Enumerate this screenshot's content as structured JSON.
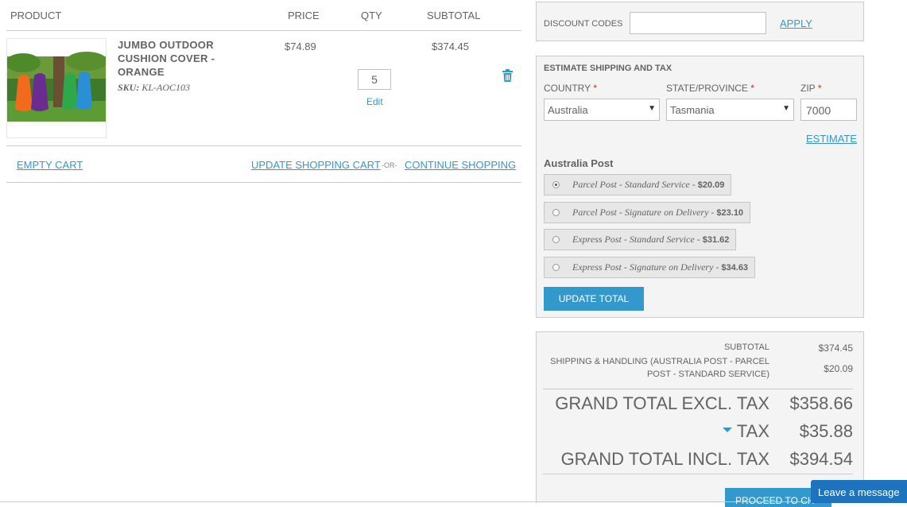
{
  "cart": {
    "headers": {
      "product": "PRODUCT",
      "price": "PRICE",
      "qty": "QTY",
      "subtotal": "SUBTOTAL"
    },
    "item": {
      "name": "JUMBO OUTDOOR CUSHION COVER - ORANGE",
      "sku_label": "SKU:",
      "sku_value": "KL-AOC103",
      "price": "$74.89",
      "qty": "5",
      "edit_label": "Edit",
      "subtotal": "$374.45",
      "remove_icon": "trash-icon"
    },
    "actions": {
      "empty_cart": "EMPTY CART",
      "update_cart": "UPDATE SHOPPING CART",
      "or": "-OR-",
      "continue": "CONTINUE SHOPPING"
    }
  },
  "discount": {
    "label": "DISCOUNT CODES",
    "value": "",
    "apply": "APPLY"
  },
  "shipping": {
    "title": "ESTIMATE SHIPPING AND TAX",
    "country_label": "COUNTRY",
    "country_value": "Australia",
    "state_label": "STATE/PROVINCE",
    "state_value": "Tasmania",
    "zip_label": "ZIP",
    "zip_value": "7000",
    "required_mark": "*",
    "estimate": "ESTIMATE",
    "carrier": "Australia Post",
    "options": [
      {
        "label": "Parcel Post - Standard Service -",
        "price": "$20.09",
        "selected": true
      },
      {
        "label": "Parcel Post - Signature on Delivery -",
        "price": "$23.10",
        "selected": false
      },
      {
        "label": "Express Post - Standard Service -",
        "price": "$31.62",
        "selected": false
      },
      {
        "label": "Express Post - Signature on Delivery -",
        "price": "$34.63",
        "selected": false
      }
    ],
    "update_total": "UPDATE TOTAL"
  },
  "totals": {
    "subtotal_label": "SUBTOTAL",
    "subtotal_value": "$374.45",
    "shipping_label_line1": "SHIPPING & HANDLING (AUSTRALIA POST - PARCEL",
    "shipping_label_line2": "POST - STANDARD SERVICE)",
    "shipping_value": "$20.09",
    "grand_excl_label": "GRAND TOTAL EXCL. TAX",
    "grand_excl_value": "$358.66",
    "tax_label": "TAX",
    "tax_value": "$35.88",
    "grand_incl_label": "GRAND TOTAL INCL. TAX",
    "grand_incl_value": "$394.54",
    "checkout": "PROCEED TO CH"
  },
  "chat": {
    "label": "Leave a message"
  },
  "colors": {
    "accent": "#3399cc",
    "required": "#df280a",
    "chat": "#1e73be"
  }
}
